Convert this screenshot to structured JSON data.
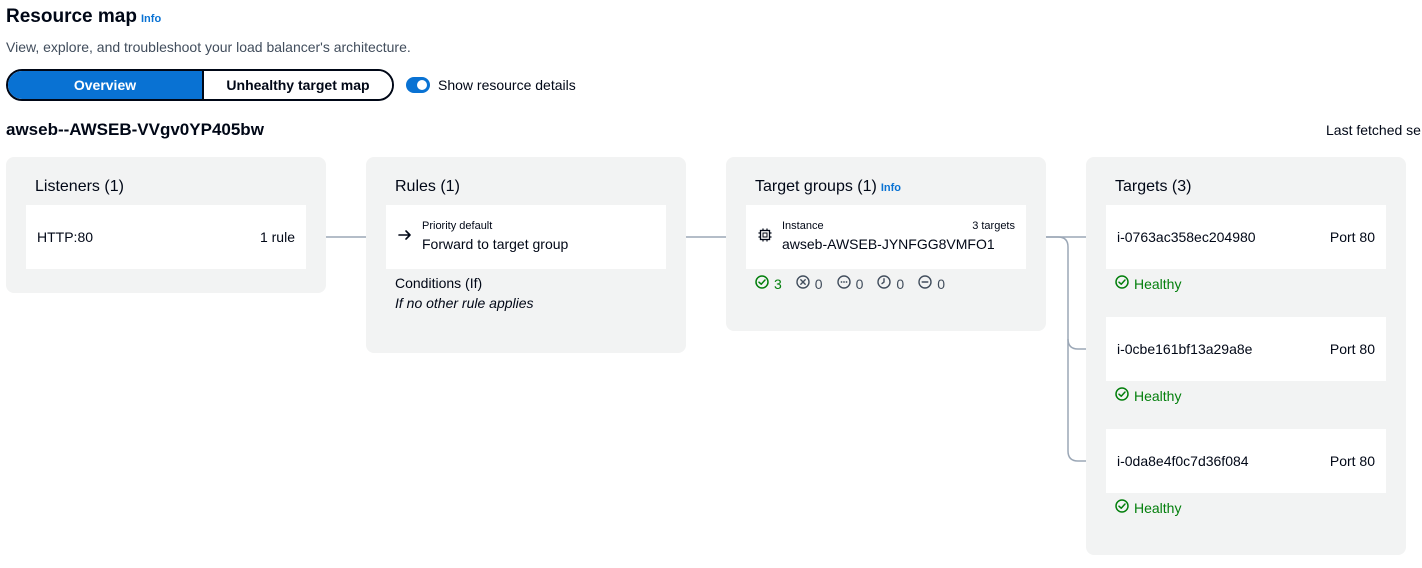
{
  "header": {
    "title": "Resource map",
    "info": "Info",
    "description": "View, explore, and troubleshoot your load balancer's architecture."
  },
  "view_toggle": {
    "overview": "Overview",
    "unhealthy": "Unhealthy target map",
    "show_details_label": "Show resource details",
    "show_details_on": true
  },
  "load_balancer": {
    "name": "awseb--AWSEB-VVgv0YP405bw",
    "last_fetched": "Last fetched se"
  },
  "listeners": {
    "title": "Listeners (1)",
    "items": [
      {
        "name": "HTTP:80",
        "rules": "1 rule"
      }
    ]
  },
  "rules": {
    "title": "Rules (1)",
    "priority": "Priority default",
    "action": "Forward to target group",
    "conditions_title": "Conditions (If)",
    "conditions_value": "If no other rule applies"
  },
  "target_groups": {
    "title": "Target groups (1)",
    "info": "Info",
    "type": "Instance",
    "count": "3 targets",
    "name": "awseb-AWSEB-JYNFGG8VMFO1",
    "status": {
      "healthy": "3",
      "unhealthy": "0",
      "unused": "0",
      "draining": "0",
      "unavailable": "0"
    }
  },
  "targets": {
    "title": "Targets (3)",
    "items": [
      {
        "id": "i-0763ac358ec204980",
        "port": "Port 80",
        "status": "Healthy"
      },
      {
        "id": "i-0cbe161bf13a29a8e",
        "port": "Port 80",
        "status": "Healthy"
      },
      {
        "id": "i-0da8e4f0c7d36f084",
        "port": "Port 80",
        "status": "Healthy"
      }
    ]
  },
  "colors": {
    "accent": "#0972d3",
    "healthy": "#037f0c",
    "panel": "#f2f3f3"
  },
  "icons": [
    "arrow-right-icon",
    "cpu-chip-icon",
    "check-circle-icon",
    "x-circle-icon",
    "dots-circle-icon",
    "clock-circle-icon",
    "minus-circle-icon"
  ]
}
